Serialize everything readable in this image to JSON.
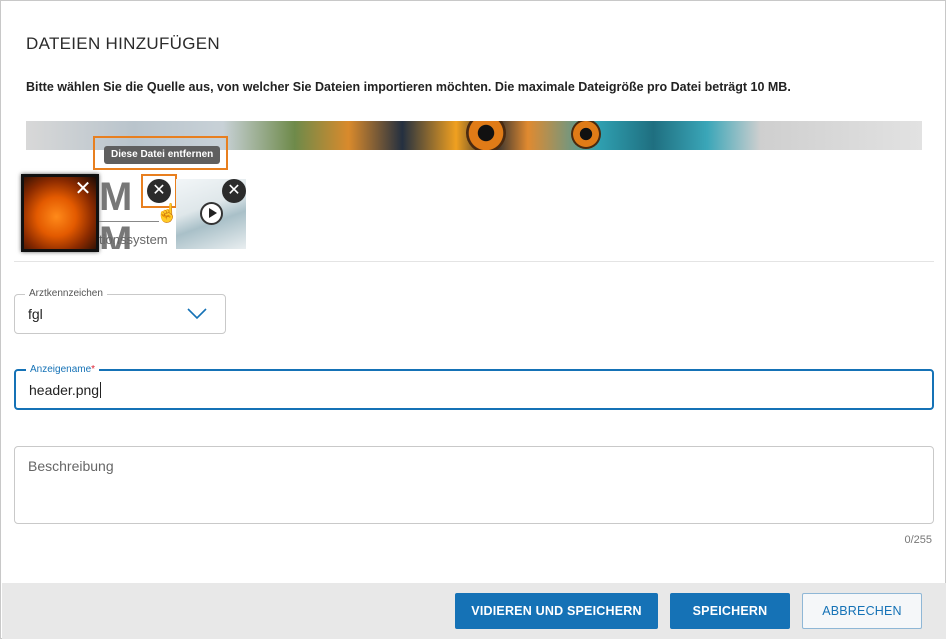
{
  "dialog": {
    "title": "DATEIEN HINZUFÜGEN",
    "intro": "Bitte wählen Sie die Quelle aus, von welcher Sie Dateien importieren möchten. Die maximale Dateigröße pro Datei beträgt 10 MB."
  },
  "tooltip": {
    "text": "Diese Datei entfernen"
  },
  "thumbnails": {
    "close_glyph": "✕",
    "logo_text_main": "M M",
    "logo_subtitle": "tionssystem"
  },
  "form": {
    "arzt": {
      "label": "Arztkennzeichen",
      "value": "fgl"
    },
    "name": {
      "label": "Anzeigename",
      "required_mark": "*",
      "value": "header.png"
    },
    "description": {
      "placeholder": "Beschreibung",
      "counter": "0/255"
    }
  },
  "footer": {
    "validate_save_label": "VIDIEREN UND SPEICHERN",
    "save_label": "SPEICHERN",
    "cancel_label": "ABBRECHEN"
  },
  "colors": {
    "primary": "#1572b6",
    "highlight": "#e87f1f"
  },
  "icons": [
    "close-icon",
    "play-icon",
    "chevron-down-icon",
    "hand-cursor-icon"
  ]
}
